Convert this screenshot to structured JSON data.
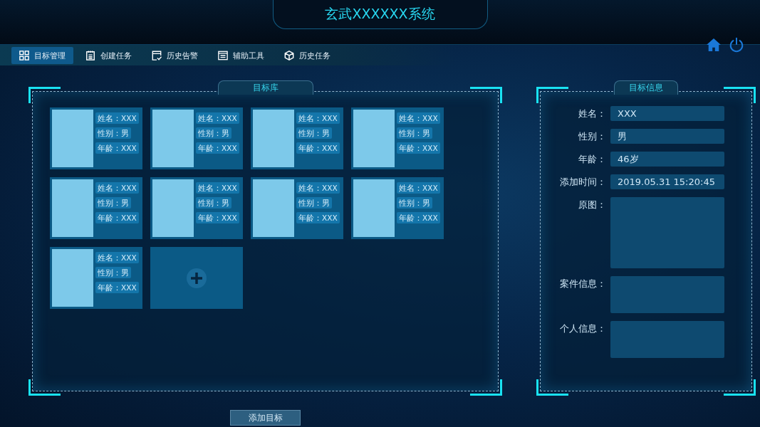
{
  "header": {
    "title": "玄武XXXXXX系统"
  },
  "nav": [
    {
      "label": "目标管理",
      "selected": true
    },
    {
      "label": "创建任务",
      "selected": false
    },
    {
      "label": "历史告警",
      "selected": false
    },
    {
      "label": "辅助工具",
      "selected": false
    },
    {
      "label": "历史任务",
      "selected": false
    }
  ],
  "library": {
    "title": "目标库",
    "targets": [
      {
        "fields": [
          "姓名：XXX",
          "性别：男",
          "年龄：XXX"
        ]
      },
      {
        "fields": [
          "姓名：XXX",
          "性别：男",
          "年龄：XXX"
        ]
      },
      {
        "fields": [
          "姓名：XXX",
          "性别：男",
          "年龄：XXX"
        ]
      },
      {
        "fields": [
          "姓名：XXX",
          "性别：男",
          "年龄：XXX"
        ]
      },
      {
        "fields": [
          "姓名：XXX",
          "性别：男",
          "年龄：XXX"
        ]
      },
      {
        "fields": [
          "姓名：XXX",
          "性别：男",
          "年龄：XXX"
        ]
      },
      {
        "fields": [
          "姓名：XXX",
          "性别：男",
          "年龄：XXX"
        ]
      },
      {
        "fields": [
          "姓名：XXX",
          "性别：男",
          "年龄：XXX"
        ]
      },
      {
        "fields": [
          "姓名：XXX",
          "性别：男",
          "年龄：XXX"
        ]
      }
    ],
    "add_button": "添加目标"
  },
  "info": {
    "title": "目标信息",
    "fields": [
      {
        "kind": "text",
        "label": "姓名：",
        "value": "XXX"
      },
      {
        "kind": "text",
        "label": "性别：",
        "value": "男"
      },
      {
        "kind": "text",
        "label": "年龄：",
        "value": "46岁"
      },
      {
        "kind": "text",
        "label": "添加时间：",
        "value": "2019.05.31 15:20:45"
      },
      {
        "kind": "image",
        "label": "原图："
      },
      {
        "kind": "box",
        "label": "案件信息："
      },
      {
        "kind": "box",
        "label": "个人信息："
      }
    ]
  }
}
